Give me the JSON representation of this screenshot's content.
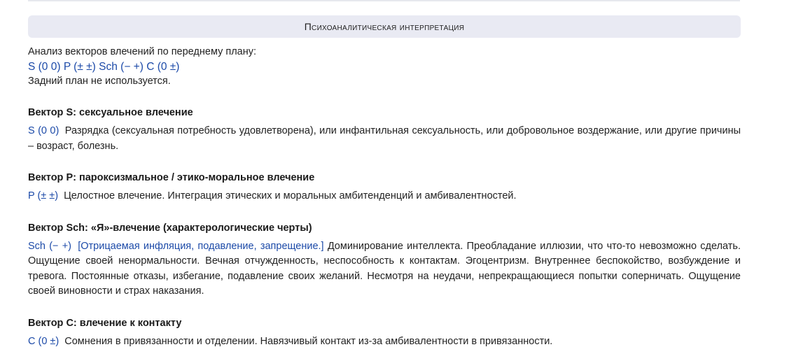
{
  "header": {
    "title": "Психоаналитическая интерпретация"
  },
  "intro": {
    "line1": "Анализ векторов влечений по переднему плану:",
    "formula": "S (0 0) P (± ±) Sch (− +) C (0 ±)",
    "line3": "Задний план не используется."
  },
  "vectors": [
    {
      "title": "Вектор S: сексуальное влечение",
      "code": "S (0 0)",
      "bracket": "",
      "text": "Разрядка (сексуальная потребность удовлетворена), или инфантильная сексуальность, или добровольное воздержание, или другие причины – возраст, болезнь."
    },
    {
      "title": "Вектор P: пароксизмальное / этико-моральное влечение",
      "code": "P (± ±)",
      "bracket": "",
      "text": "Целостное влечение. Интеграция этических и моральных амбитенденций и амбивалентностей."
    },
    {
      "title": "Вектор Sch: «Я»-влечение (характерологические черты)",
      "code": "Sch (− +)",
      "bracket": "[Отрицаемая инфляция, подавление, запрещение.]",
      "text": "Доминирование интеллекта. Преобладание иллюзии, что что-то невозможно сделать. Ощущение своей ненормальности. Вечная отчужденность, неспособность к контактам. Эгоцентризм. Внутреннее беспокойство, возбуждение и тревога. Постоянные отказы, избегание, подавление своих желаний. Несмотря на неудачи, непрекращающиеся попытки соперничать. Ощущение своей виновности и страх наказания."
    },
    {
      "title": "Вектор C: влечение к контакту",
      "code": "C (0 ±)",
      "bracket": "",
      "text": "Сомнения в привязанности и отделении. Навязчивый контакт из-за амбивалентности в привязанности."
    }
  ]
}
